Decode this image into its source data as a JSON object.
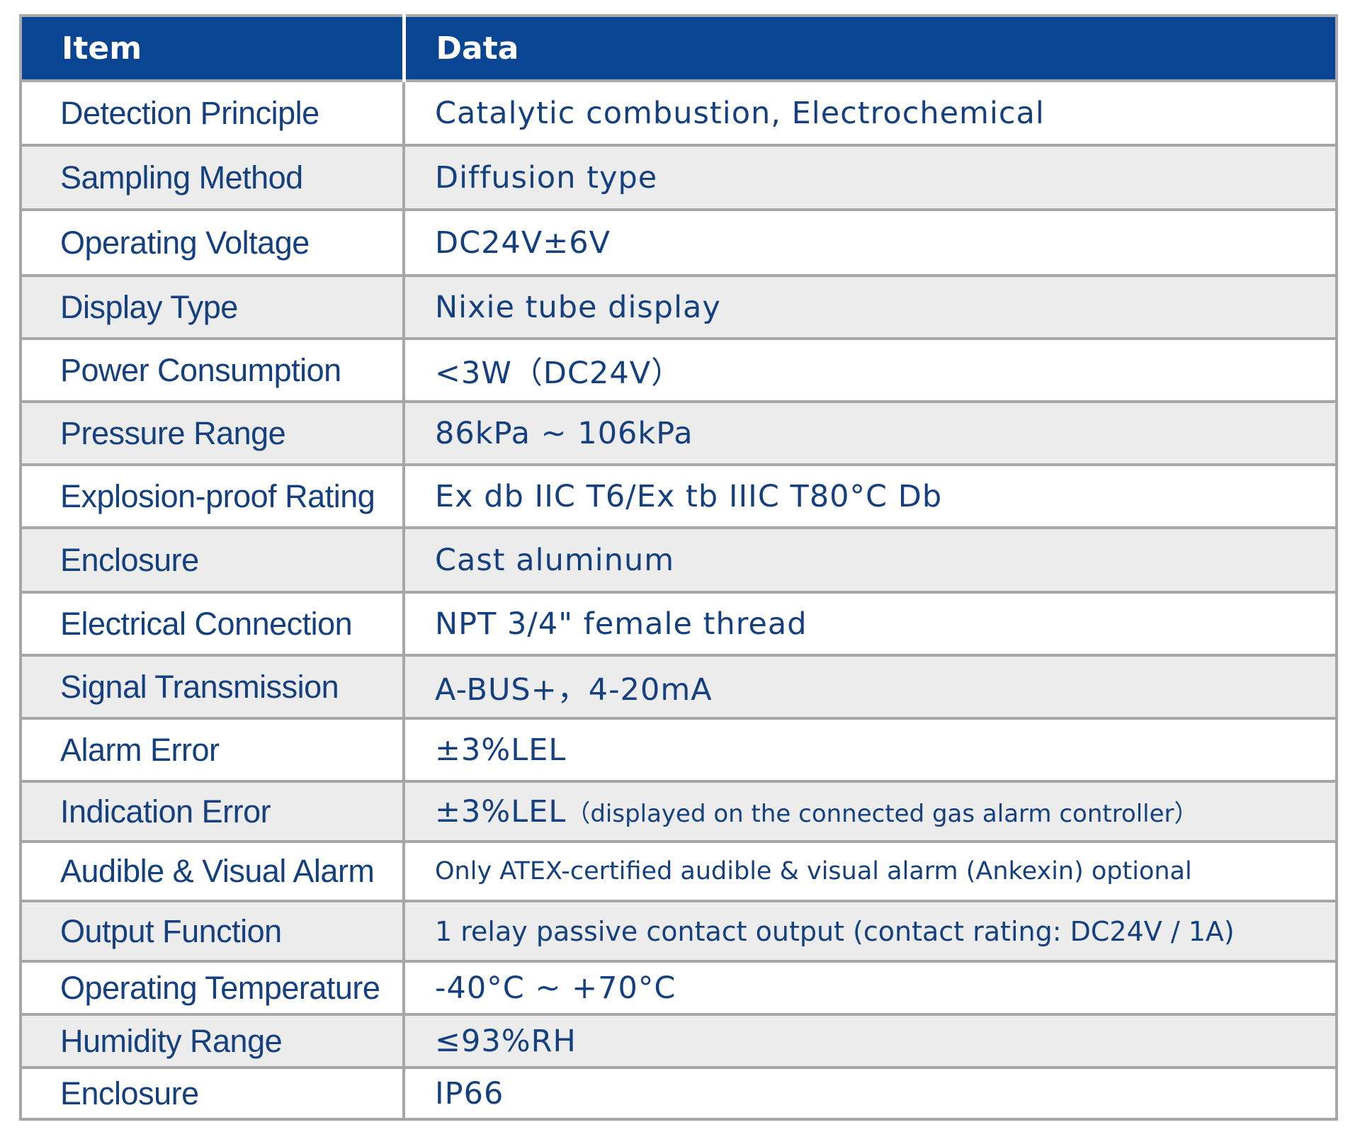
{
  "header": {
    "item": "Item",
    "data": "Data"
  },
  "rows": [
    {
      "item": "Detection Principle",
      "value": "Catalytic combustion, Electrochemical"
    },
    {
      "item": "Sampling Method",
      "value": "Diffusion type"
    },
    {
      "item": "Operating Voltage",
      "value": "DC24V±6V"
    },
    {
      "item": "Display Type",
      "value": "Nixie tube display"
    },
    {
      "item": "Power Consumption",
      "value": "<3W（DC24V）"
    },
    {
      "item": "Pressure Range",
      "value": "86kPa ~ 106kPa"
    },
    {
      "item": "Explosion-proof Rating",
      "value": "Ex db IIC T6/Ex tb IIIC T80°C Db"
    },
    {
      "item": "Enclosure",
      "value": "Cast aluminum"
    },
    {
      "item": "Electrical Connection",
      "value": "NPT 3/4\" female thread"
    },
    {
      "item": "Signal Transmission",
      "value": "A-BUS+，4-20mA"
    },
    {
      "item": "Alarm Error",
      "value": "±3%LEL"
    },
    {
      "item": "Indication Error",
      "value": "±3%LEL",
      "note": "（displayed on the connected gas alarm controller）"
    },
    {
      "item": "Audible & Visual Alarm",
      "value": "Only ATEX-certified audible & visual alarm (Ankexin) optional"
    },
    {
      "item": "Output Function",
      "value": "1 relay passive contact output (contact rating: DC24V / 1A)"
    },
    {
      "item": "Operating Temperature",
      "value": "-40°C ~ +70°C"
    },
    {
      "item": "Humidity Range",
      "value": "≤93%RH"
    },
    {
      "item": "Enclosure",
      "value": "IP66"
    }
  ]
}
